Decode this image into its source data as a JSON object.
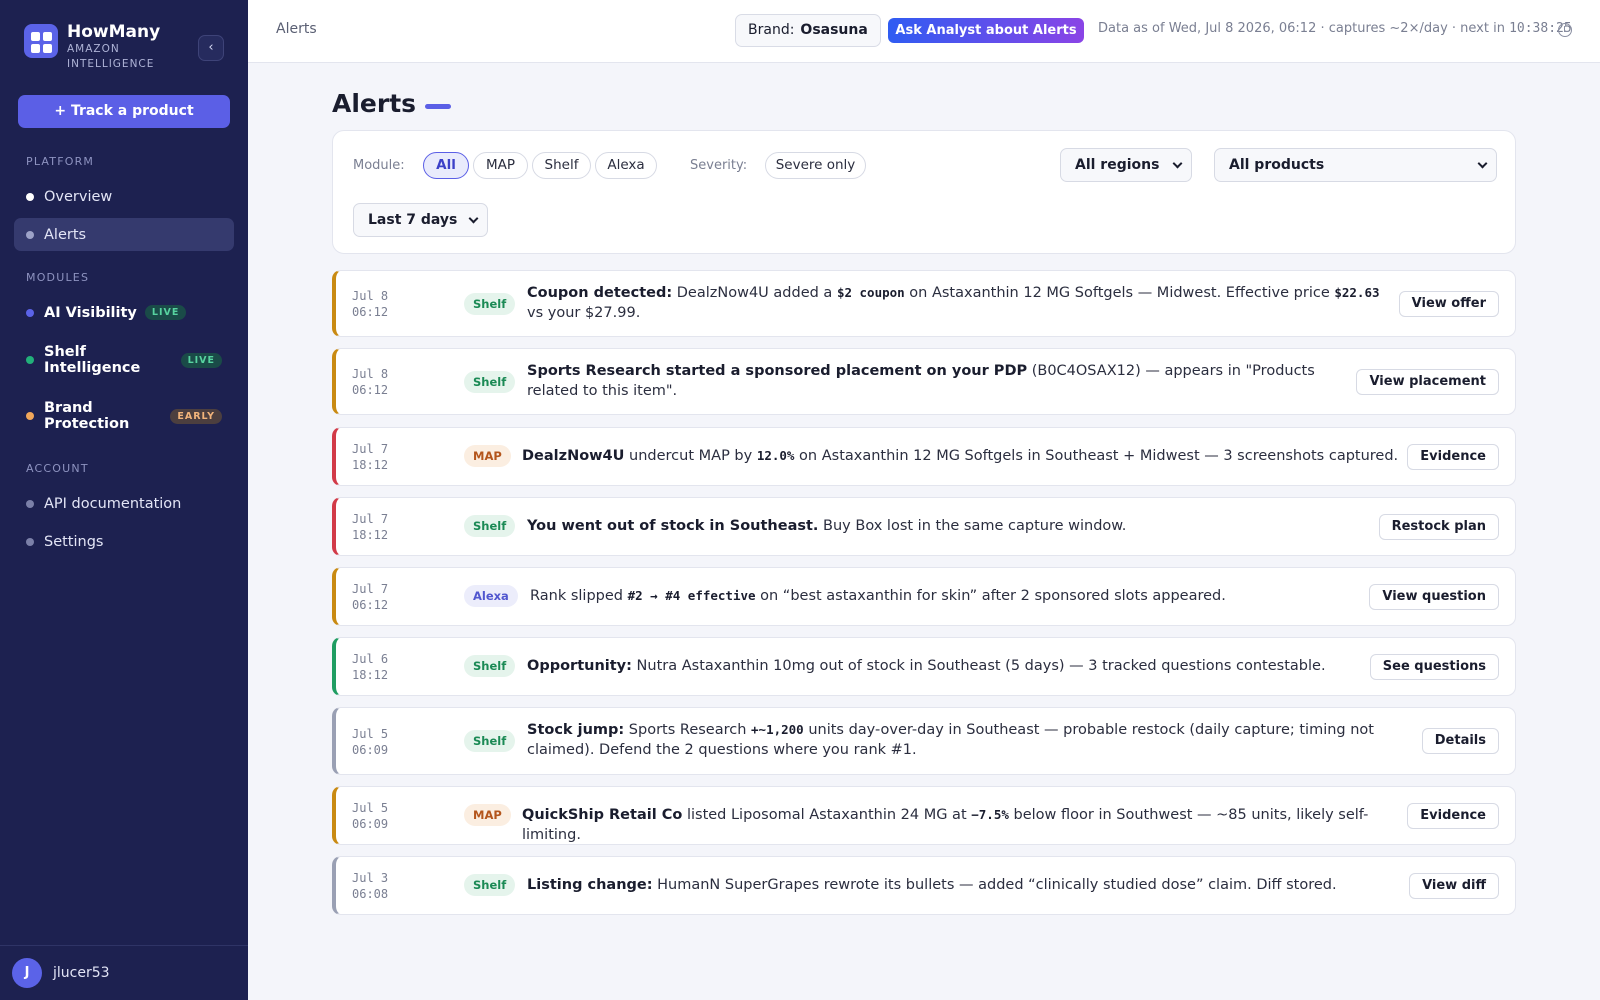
{
  "sidebar": {
    "brand_name": "HowMany",
    "brand_sub": "AMAZON INTELLIGENCE",
    "collapse_icon": "chevron-left-icon",
    "track_button": "+ Track a product",
    "sections": {
      "platform": "PLATFORM",
      "modules": "MODULES",
      "account": "ACCOUNT"
    },
    "items": {
      "overview": "Overview",
      "alerts": "Alerts",
      "ai_visibility": "AI Visibility",
      "shelf_intelligence": "Shelf Intelligence",
      "brand_protection": "Brand Protection",
      "api_docs": "API documentation",
      "settings": "Settings"
    },
    "tags": {
      "live": "LIVE",
      "early": "EARLY"
    },
    "user": {
      "initial": "J",
      "name": "jlucer53"
    }
  },
  "topbar": {
    "breadcrumb": "Alerts",
    "brand_label": "Brand:",
    "brand_value": "Osasuna",
    "ask_button": "Ask Analyst about Alerts",
    "data_as_of": "Data as of Wed, Jul 8 2026, 06:12 · captures ~2×/day · next in ",
    "countdown": "10:38:25",
    "info_icon": "clock-icon"
  },
  "page": {
    "title": "Alerts"
  },
  "filters": {
    "module_label": "Module:",
    "modules": [
      "All",
      "MAP",
      "Shelf",
      "Alexa"
    ],
    "module_selected": "All",
    "severity_label": "Severity:",
    "severity_chip": "Severe only",
    "region_select": "All regions",
    "product_select": "All products",
    "period_select": "Last 7 days"
  },
  "alerts": [
    {
      "date": "Jul 8",
      "time": "06:12",
      "badge": "Shelf",
      "severity_color": "#c98a12",
      "parts": [
        "Coupon detected:",
        " DealzNow4U added a ",
        "$2 coupon",
        " on Astaxanthin 12 MG Softgels — Midwest. Effective price ",
        "$22.63",
        " vs your $27.99."
      ],
      "action": "View offer"
    },
    {
      "date": "Jul 8",
      "time": "06:12",
      "badge": "Shelf",
      "severity_color": "#c98a12",
      "parts": [
        "Sports Research started a sponsored placement on your PDP",
        " (B0C4OSAX12) — appears in \"Products related to this item\"."
      ],
      "action": "View placement"
    },
    {
      "date": "Jul 7",
      "time": "18:12",
      "badge": "MAP",
      "severity_color": "#d23a48",
      "parts": [
        "DealzNow4U",
        " undercut MAP by ",
        "12.0%",
        " on Astaxanthin 12 MG Softgels in Southeast + Midwest — 3 screenshots captured."
      ],
      "action": "Evidence"
    },
    {
      "date": "Jul 7",
      "time": "18:12",
      "badge": "Shelf",
      "severity_color": "#d23a48",
      "parts": [
        "You went out of stock in Southeast.",
        " Buy Box lost in the same capture window."
      ],
      "action": "Restock plan"
    },
    {
      "date": "Jul 7",
      "time": "06:12",
      "badge": "Alexa",
      "severity_color": "#c98a12",
      "parts": [
        "Rank slipped ",
        "#2 → #4 effective",
        " on “best astaxanthin for skin” after 2 sponsored slots appeared."
      ],
      "action": "View question"
    },
    {
      "date": "Jul 6",
      "time": "18:12",
      "badge": "Shelf",
      "severity_color": "#1f9d62",
      "parts": [
        "Opportunity:",
        " Nutra Astaxanthin 10mg out of stock in Southeast (5 days) — 3 tracked questions contestable."
      ],
      "action": "See questions"
    },
    {
      "date": "Jul 5",
      "time": "06:09",
      "badge": "Shelf",
      "severity_color": "#9aa0b4",
      "parts": [
        "Stock jump:",
        " Sports Research ",
        "+~1,200",
        " units day-over-day in Southeast — probable restock (daily capture; timing not claimed). Defend the 2 questions where you rank #1."
      ],
      "action": "Details"
    },
    {
      "date": "Jul 5",
      "time": "06:09",
      "badge": "MAP",
      "severity_color": "#c98a12",
      "parts": [
        "QuickShip Retail Co",
        " listed Liposomal Astaxanthin 24 MG at ",
        "−7.5%",
        " below floor in Southwest — ~85 units, likely self-limiting."
      ],
      "action": "Evidence"
    },
    {
      "date": "Jul 3",
      "time": "06:08",
      "badge": "Shelf",
      "severity_color": "#9aa0b4",
      "parts": [
        "Listing change:",
        " HumanN SuperGrapes rewrote its bullets — added “clinically studied dose” claim. Diff stored."
      ],
      "action": "View diff"
    }
  ]
}
